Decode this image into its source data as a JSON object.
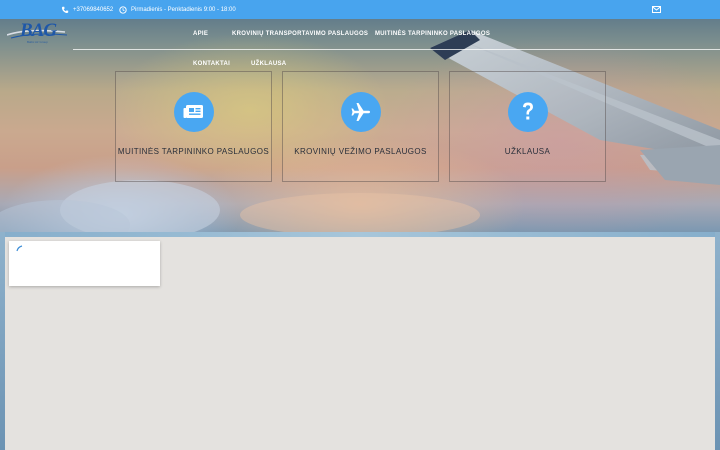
{
  "topbar": {
    "phone": "+37069840652",
    "hours": "Pirmadienis - Penktadienis 9:00 - 18:00",
    "phone_icon": "phone-icon",
    "clock_icon": "clock-icon",
    "mail_icon": "envelope-icon"
  },
  "logo": {
    "text": "BAG",
    "tagline": "Baltic Air Group"
  },
  "nav": {
    "items": [
      {
        "label": "Apie"
      },
      {
        "label": "Krovinių transportavimo paslaugos"
      },
      {
        "label": "Muitinės tarpininko paslaugos"
      },
      {
        "label": "Kontaktai"
      },
      {
        "label": "Užklausa"
      }
    ]
  },
  "cards": [
    {
      "label": "Muitinės tarpininko paslaugos",
      "icon": "newspaper-icon"
    },
    {
      "label": "Krovinių vežimo paslaugos",
      "icon": "airplane-icon"
    },
    {
      "label": "Užklausa",
      "icon": "question-icon"
    }
  ],
  "colors": {
    "accent": "#48a4ee",
    "card_text": "#2a2f3a",
    "logo_blue": "#1e57a8"
  }
}
